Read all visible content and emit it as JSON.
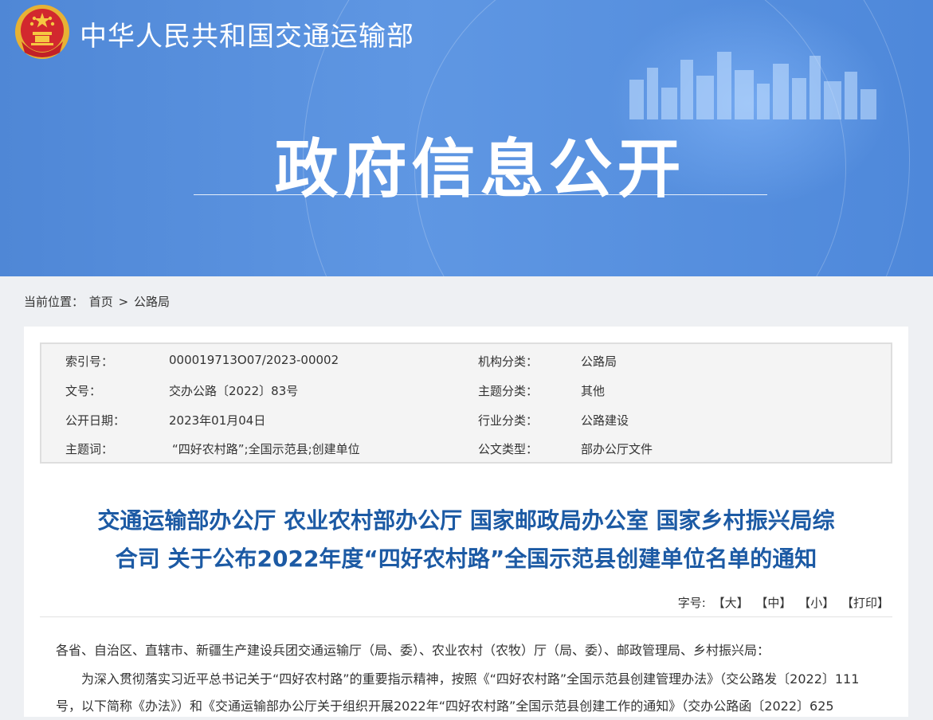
{
  "header": {
    "site_name": "中华人民共和国交通运输部",
    "banner_title": "政府信息公开"
  },
  "breadcrumb": {
    "prefix": "当前位置：",
    "home": "首页",
    "separator": ">",
    "current": "公路局"
  },
  "meta": {
    "rows": [
      {
        "label1": "索引号：",
        "value1": "000019713O07/2023-00002",
        "label2": "机构分类：",
        "value2": "公路局"
      },
      {
        "label1": "文号：",
        "value1": "交办公路〔2022〕83号",
        "label2": "主题分类：",
        "value2": "其他"
      },
      {
        "label1": "公开日期：",
        "value1": "2023年01月04日",
        "label2": "行业分类：",
        "value2": "公路建设"
      },
      {
        "label1": "主题词：",
        "value1": "“四好农村路”;全国示范县;创建单位",
        "label2": "公文类型：",
        "value2": "部办公厅文件"
      }
    ]
  },
  "document": {
    "title_line1": "交通运输部办公厅 农业农村部办公厅 国家邮政局办公室 国家乡村振兴局综",
    "title_line2": "合司 关于公布2022年度“四好农村路”全国示范县创建单位名单的通知",
    "salutation": "各省、自治区、直辖市、新疆生产建设兵团交通运输厅（局、委）、农业农村（农牧）厅（局、委）、邮政管理局、乡村振兴局：",
    "paragraph1": "为深入贯彻落实习近平总书记关于“四好农村路”的重要指示精神，按照《“四好农村路”全国示范县创建管理办法》（交公路发〔2022〕111号，以下简称《办法》）和《交通运输部办公厅关于组织开展2022年“四好农村路”全国示范县创建工作的通知》（交办公路函〔2022〕625"
  },
  "fontbar": {
    "label": "字号:",
    "large": "【大】",
    "medium": "【中】",
    "small": "【小】",
    "print": "【打印】"
  },
  "colors": {
    "banner": "#5b93e0",
    "title": "#1c5aa4"
  }
}
